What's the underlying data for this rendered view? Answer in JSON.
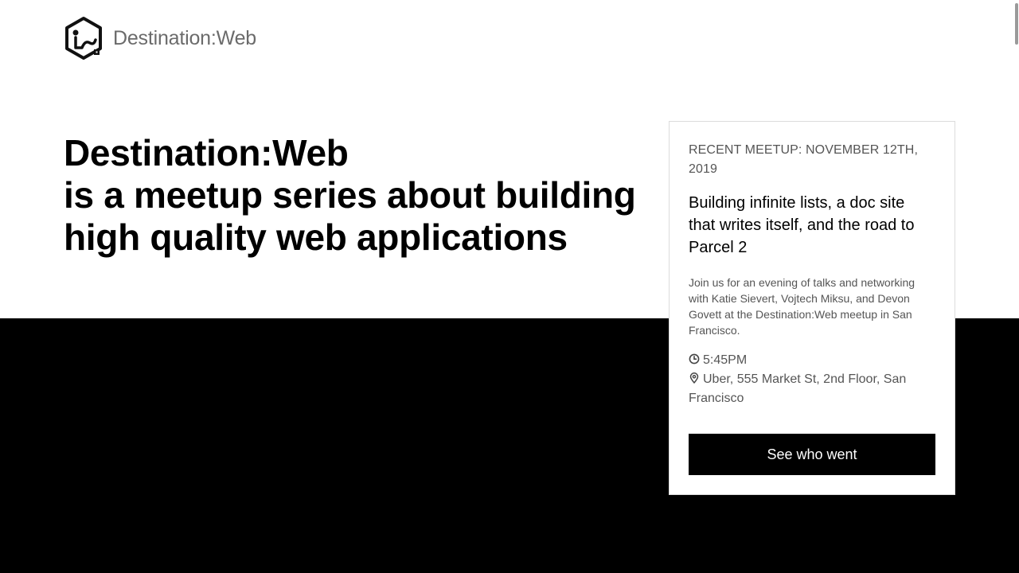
{
  "header": {
    "brand": "Destination:Web",
    "logo_icon": "destination-web-hexagon-logo"
  },
  "hero": {
    "line1": "Destination:Web",
    "line2": "is a meetup series about building high quality web applications"
  },
  "card": {
    "eyebrow": "RECENT MEETUP: NOVEMBER 12TH, 2019",
    "title": "Building infinite lists, a doc site that writes itself, and the road to Parcel 2",
    "description": "Join us for an evening of talks and networking with Katie Sievert, Vojtech Miksu, and Devon Govett at the Destination:Web meetup in San Francisco.",
    "time": "5:45PM",
    "time_icon": "clock-icon",
    "location": "Uber, 555 Market St, 2nd Floor, San Francisco",
    "location_icon": "map-pin-icon",
    "cta_label": "See who went"
  },
  "colors": {
    "band": "#000000",
    "brand_text": "#6b6b6b",
    "muted_text": "#555555",
    "button_bg": "#000000",
    "button_text": "#ffffff"
  }
}
